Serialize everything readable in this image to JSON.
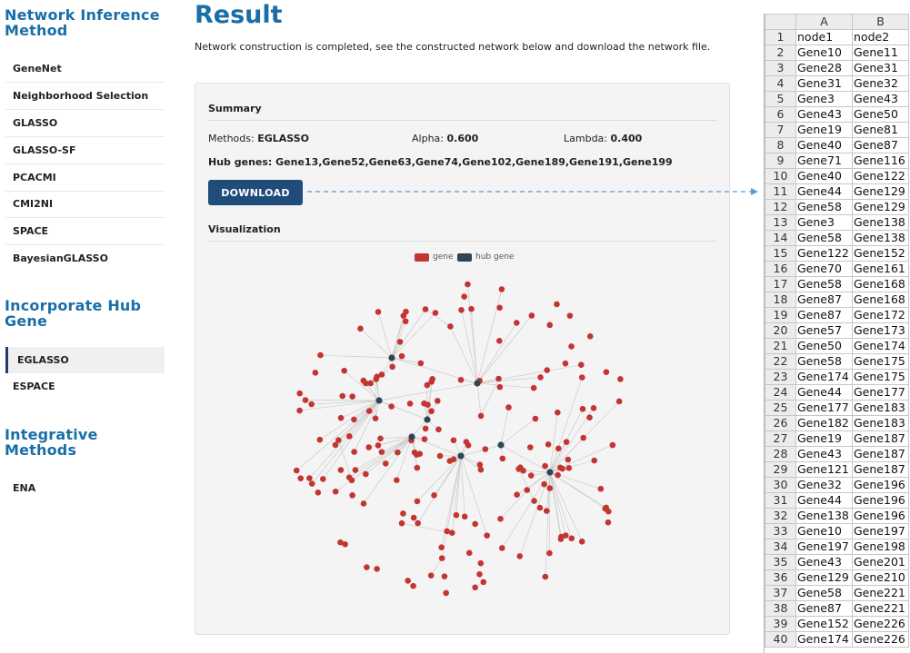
{
  "sidebar": {
    "sections": [
      {
        "title": "Network Inference Method"
      },
      {
        "title": "Incorporate Hub Gene"
      },
      {
        "title": "Integrative Methods"
      }
    ],
    "inference_items": [
      "GeneNet",
      "Neighborhood Selection",
      "GLASSO",
      "GLASSO-SF",
      "PCACMI",
      "CMI2NI",
      "SPACE",
      "BayesianGLASSO"
    ],
    "hub_items": [
      "EGLASSO",
      "ESPACE"
    ],
    "integrative_items": [
      "ENA"
    ],
    "active_item": "EGLASSO"
  },
  "main": {
    "title": "Result",
    "description": "Network construction is completed, see the constructed network below and download the network file.",
    "summary_heading": "Summary",
    "methods_label": "Methods:",
    "methods_value": "EGLASSO",
    "alpha_label": "Alpha:",
    "alpha_value": "0.600",
    "lambda_label": "Lambda:",
    "lambda_value": "0.400",
    "hub_genes_text": "Hub genes: Gene13,Gene52,Gene63,Gene74,Gene102,Gene189,Gene191,Gene199",
    "download_label": "DOWNLOAD",
    "visualization_heading": "Visualization",
    "legend": [
      {
        "label": "gene",
        "color": "#c23531"
      },
      {
        "label": "hub gene",
        "color": "#2f4554"
      }
    ]
  },
  "colors": {
    "accent": "#1a6ea8",
    "button": "#1f4c79",
    "gene_node": "#c23531",
    "hub_node": "#2f4554",
    "edge": "#cccccc",
    "arrow": "#5b9bd5"
  },
  "spreadsheet": {
    "columns": [
      "A",
      "B"
    ],
    "rows": [
      [
        "node1",
        "node2"
      ],
      [
        "Gene10",
        "Gene11"
      ],
      [
        "Gene28",
        "Gene31"
      ],
      [
        "Gene31",
        "Gene32"
      ],
      [
        "Gene3",
        "Gene43"
      ],
      [
        "Gene43",
        "Gene50"
      ],
      [
        "Gene19",
        "Gene81"
      ],
      [
        "Gene40",
        "Gene87"
      ],
      [
        "Gene71",
        "Gene116"
      ],
      [
        "Gene40",
        "Gene122"
      ],
      [
        "Gene44",
        "Gene129"
      ],
      [
        "Gene58",
        "Gene129"
      ],
      [
        "Gene3",
        "Gene138"
      ],
      [
        "Gene58",
        "Gene138"
      ],
      [
        "Gene122",
        "Gene152"
      ],
      [
        "Gene70",
        "Gene161"
      ],
      [
        "Gene58",
        "Gene168"
      ],
      [
        "Gene87",
        "Gene168"
      ],
      [
        "Gene87",
        "Gene172"
      ],
      [
        "Gene57",
        "Gene173"
      ],
      [
        "Gene50",
        "Gene174"
      ],
      [
        "Gene58",
        "Gene175"
      ],
      [
        "Gene174",
        "Gene175"
      ],
      [
        "Gene44",
        "Gene177"
      ],
      [
        "Gene177",
        "Gene183"
      ],
      [
        "Gene182",
        "Gene183"
      ],
      [
        "Gene19",
        "Gene187"
      ],
      [
        "Gene43",
        "Gene187"
      ],
      [
        "Gene121",
        "Gene187"
      ],
      [
        "Gene32",
        "Gene196"
      ],
      [
        "Gene44",
        "Gene196"
      ],
      [
        "Gene138",
        "Gene196"
      ],
      [
        "Gene10",
        "Gene197"
      ],
      [
        "Gene197",
        "Gene198"
      ],
      [
        "Gene43",
        "Gene201"
      ],
      [
        "Gene129",
        "Gene210"
      ],
      [
        "Gene58",
        "Gene221"
      ],
      [
        "Gene87",
        "Gene221"
      ],
      [
        "Gene152",
        "Gene226"
      ],
      [
        "Gene174",
        "Gene226"
      ]
    ]
  }
}
